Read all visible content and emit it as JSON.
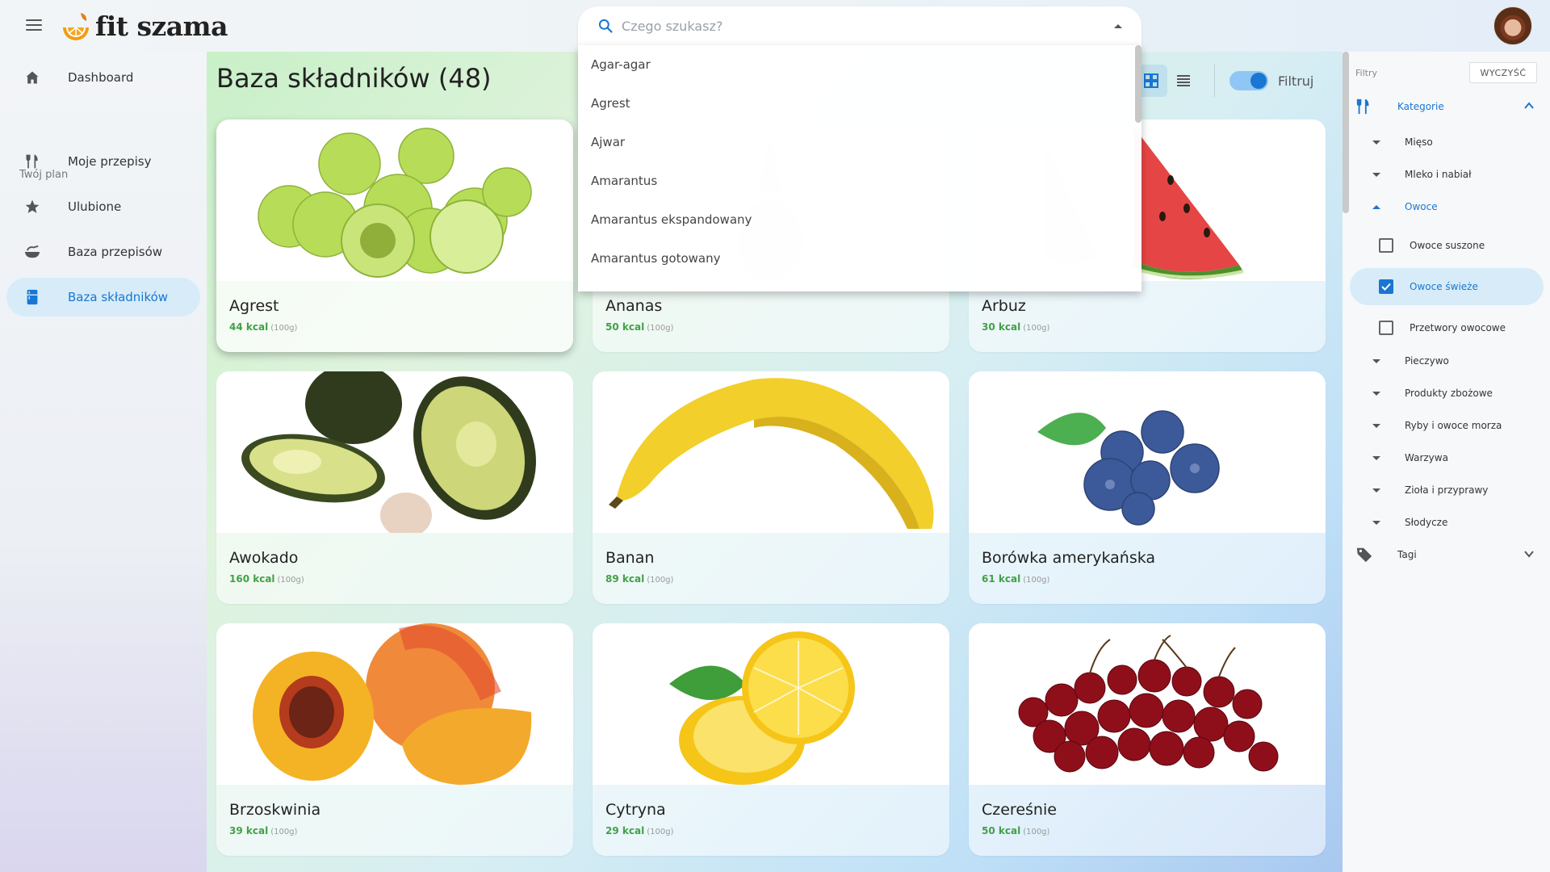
{
  "app": {
    "brand": "fit szama"
  },
  "search": {
    "placeholder": "Czego szukasz?",
    "value": ""
  },
  "search_options": [
    "Agar-agar",
    "Agrest",
    "Ajwar",
    "Amarantus",
    "Amarantus ekspandowany",
    "Amarantus gotowany"
  ],
  "sidebar": {
    "items": [
      {
        "label": "Dashboard",
        "icon": "home-icon"
      },
      {
        "label": "Moje przepisy",
        "icon": "fork-knife-icon"
      },
      {
        "label": "Ulubione",
        "icon": "star-icon"
      },
      {
        "label": "Baza przepisów",
        "icon": "bowl-icon"
      },
      {
        "label": "Baza składników",
        "icon": "fridge-icon",
        "active": true
      }
    ],
    "section_label": "Twój plan"
  },
  "main": {
    "title": "Baza składników (48)",
    "filter_toggle_label": "Filtruj",
    "filter_toggle_on": true,
    "cards": [
      {
        "name": "Agrest",
        "kcal": "44 kcal",
        "unit": "(100g)"
      },
      {
        "name": "Ananas",
        "kcal": "50 kcal",
        "unit": "(100g)"
      },
      {
        "name": "Arbuz",
        "kcal": "30 kcal",
        "unit": "(100g)"
      },
      {
        "name": "Awokado",
        "kcal": "160 kcal",
        "unit": "(100g)"
      },
      {
        "name": "Banan",
        "kcal": "89 kcal",
        "unit": "(100g)"
      },
      {
        "name": "Borówka amerykańska",
        "kcal": "61 kcal",
        "unit": "(100g)"
      },
      {
        "name": "Brzoskwinia",
        "kcal": "39 kcal",
        "unit": "(100g)"
      },
      {
        "name": "Cytryna",
        "kcal": "29 kcal",
        "unit": "(100g)"
      },
      {
        "name": "Czereśnie",
        "kcal": "50 kcal",
        "unit": "(100g)"
      }
    ]
  },
  "filters": {
    "title": "Filtry",
    "clear_label": "WYCZYŚĆ",
    "categories_label": "Kategorie",
    "tags_label": "Tagi",
    "groups": [
      "Mięso",
      "Mleko i nabiał",
      "Owoce",
      "Pieczywo",
      "Produkty zbożowe",
      "Ryby i owoce morza",
      "Warzywa",
      "Zioła i przyprawy",
      "Słodycze"
    ],
    "fruit_subcategories": [
      {
        "label": "Owoce suszone",
        "checked": false
      },
      {
        "label": "Owoce świeże",
        "checked": true
      },
      {
        "label": "Przetwory owocowe",
        "checked": false
      }
    ]
  },
  "colors": {
    "accent": "#1976d2",
    "kcal": "#43a047",
    "active_bg": "#d7ecf8"
  }
}
